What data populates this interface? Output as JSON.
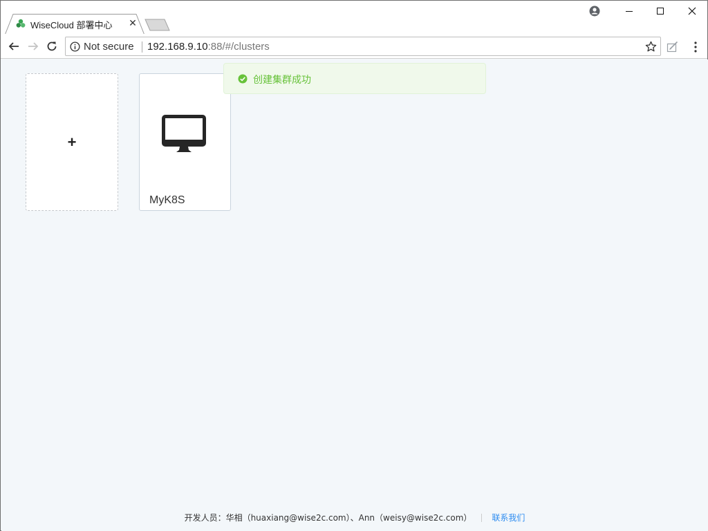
{
  "browser": {
    "tab": {
      "title": "WiseCloud 部署中心",
      "close": "✕"
    },
    "omnibox": {
      "security_label": "Not secure",
      "url_host": "192.168.9.10",
      "url_rest": ":88/#/clusters"
    },
    "icons": {
      "favicon": "wisecloud-logo-icon",
      "back": "arrow-left-icon",
      "forward": "arrow-right-icon",
      "reload": "reload-icon",
      "info": "info-icon",
      "bookmark": "star-icon",
      "extension": "extension-icon",
      "menu": "kebab-menu-icon",
      "profile": "profile-icon"
    }
  },
  "clusters": {
    "add_label": "+",
    "items": [
      {
        "name": "MyK8S",
        "icon": "monitor-icon"
      }
    ]
  },
  "toast": {
    "message": "创建集群成功",
    "icon": "check-circle-icon",
    "color": "#67c23a"
  },
  "footer": {
    "developers": "开发人员：华相（huaxiang@wise2c.com）、Ann（weisy@wise2c.com）",
    "contact": "联系我们"
  },
  "colors": {
    "page_bg": "#f3f7fa",
    "link": "#2d8cf0",
    "success": "#67c23a"
  }
}
